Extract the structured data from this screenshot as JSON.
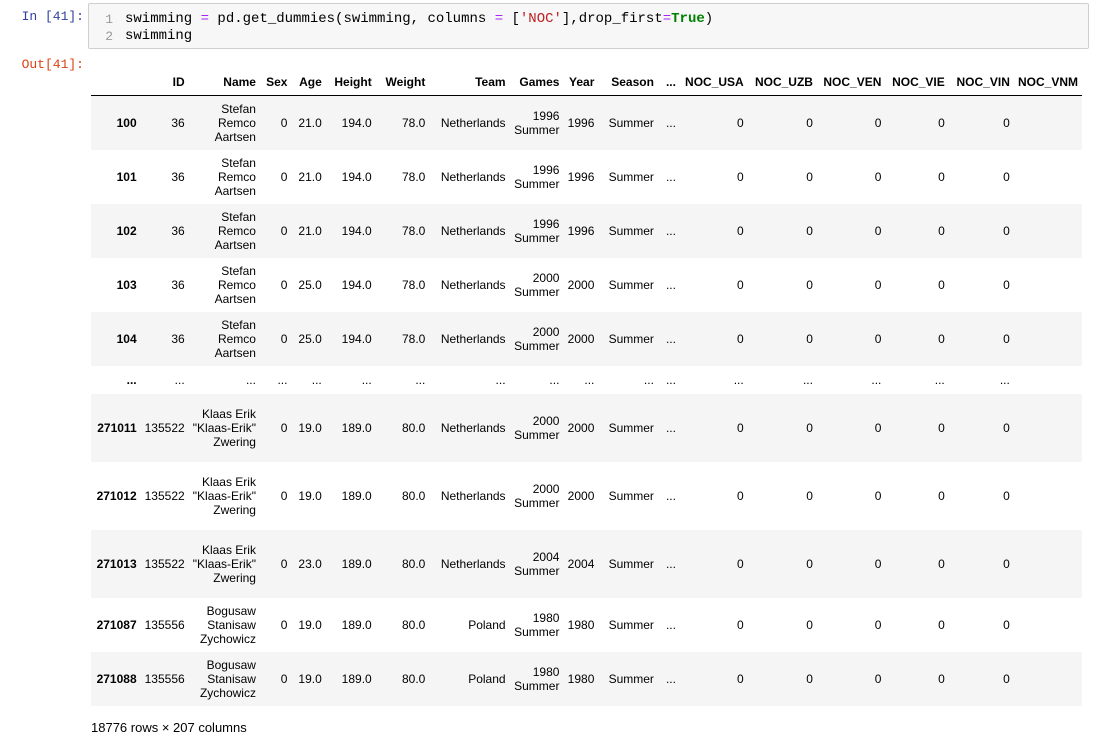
{
  "cell": {
    "in_prompt": "In [41]:",
    "out_prompt": "Out[41]:",
    "line_numbers": [
      "1",
      "2"
    ],
    "code": {
      "l1_a": "swimming ",
      "l1_eq": "=",
      "l1_b": " pd.get_dummies(swimming, columns ",
      "l1_eq2": "=",
      "l1_c": " [",
      "l1_str": "'NOC'",
      "l1_d": "],drop_first",
      "l1_eq3": "=",
      "l1_kw": "True",
      "l1_e": ")",
      "l2": "swimming"
    }
  },
  "table": {
    "columns": [
      "",
      "ID",
      "Name",
      "Sex",
      "Age",
      "Height",
      "Weight",
      "Team",
      "Games",
      "Year",
      "Season",
      "...",
      "NOC_USA",
      "NOC_UZB",
      "NOC_VEN",
      "NOC_VIE",
      "NOC_VIN",
      "NOC_VNM"
    ],
    "rows": [
      [
        "100",
        "36",
        "Stefan Remco Aartsen",
        "0",
        "21.0",
        "194.0",
        "78.0",
        "Netherlands",
        "1996 Summer",
        "1996",
        "Summer",
        "...",
        "0",
        "0",
        "0",
        "0",
        "0",
        ""
      ],
      [
        "101",
        "36",
        "Stefan Remco Aartsen",
        "0",
        "21.0",
        "194.0",
        "78.0",
        "Netherlands",
        "1996 Summer",
        "1996",
        "Summer",
        "...",
        "0",
        "0",
        "0",
        "0",
        "0",
        ""
      ],
      [
        "102",
        "36",
        "Stefan Remco Aartsen",
        "0",
        "21.0",
        "194.0",
        "78.0",
        "Netherlands",
        "1996 Summer",
        "1996",
        "Summer",
        "...",
        "0",
        "0",
        "0",
        "0",
        "0",
        ""
      ],
      [
        "103",
        "36",
        "Stefan Remco Aartsen",
        "0",
        "25.0",
        "194.0",
        "78.0",
        "Netherlands",
        "2000 Summer",
        "2000",
        "Summer",
        "...",
        "0",
        "0",
        "0",
        "0",
        "0",
        ""
      ],
      [
        "104",
        "36",
        "Stefan Remco Aartsen",
        "0",
        "25.0",
        "194.0",
        "78.0",
        "Netherlands",
        "2000 Summer",
        "2000",
        "Summer",
        "...",
        "0",
        "0",
        "0",
        "0",
        "0",
        ""
      ],
      [
        "...",
        "...",
        "...",
        "...",
        "...",
        "...",
        "...",
        "...",
        "...",
        "...",
        "...",
        "...",
        "...",
        "...",
        "...",
        "...",
        "...",
        ""
      ],
      [
        "271011",
        "135522",
        "Klaas Erik \"Klaas-Erik\" Zwering",
        "0",
        "19.0",
        "189.0",
        "80.0",
        "Netherlands",
        "2000 Summer",
        "2000",
        "Summer",
        "...",
        "0",
        "0",
        "0",
        "0",
        "0",
        ""
      ],
      [
        "271012",
        "135522",
        "Klaas Erik \"Klaas-Erik\" Zwering",
        "0",
        "19.0",
        "189.0",
        "80.0",
        "Netherlands",
        "2000 Summer",
        "2000",
        "Summer",
        "...",
        "0",
        "0",
        "0",
        "0",
        "0",
        ""
      ],
      [
        "271013",
        "135522",
        "Klaas Erik \"Klaas-Erik\" Zwering",
        "0",
        "23.0",
        "189.0",
        "80.0",
        "Netherlands",
        "2004 Summer",
        "2004",
        "Summer",
        "...",
        "0",
        "0",
        "0",
        "0",
        "0",
        ""
      ],
      [
        "271087",
        "135556",
        "Bogusaw Stanisaw Zychowicz",
        "0",
        "19.0",
        "189.0",
        "80.0",
        "Poland",
        "1980 Summer",
        "1980",
        "Summer",
        "...",
        "0",
        "0",
        "0",
        "0",
        "0",
        ""
      ],
      [
        "271088",
        "135556",
        "Bogusaw Stanisaw Zychowicz",
        "0",
        "19.0",
        "189.0",
        "80.0",
        "Poland",
        "1980 Summer",
        "1980",
        "Summer",
        "...",
        "0",
        "0",
        "0",
        "0",
        "0",
        ""
      ]
    ],
    "row_kinds": [
      "h54",
      "h54",
      "h54",
      "h54",
      "h54",
      "ell",
      "h68",
      "h68",
      "h68",
      "h54",
      "h54"
    ]
  },
  "footer": "18776 rows × 207 columns"
}
